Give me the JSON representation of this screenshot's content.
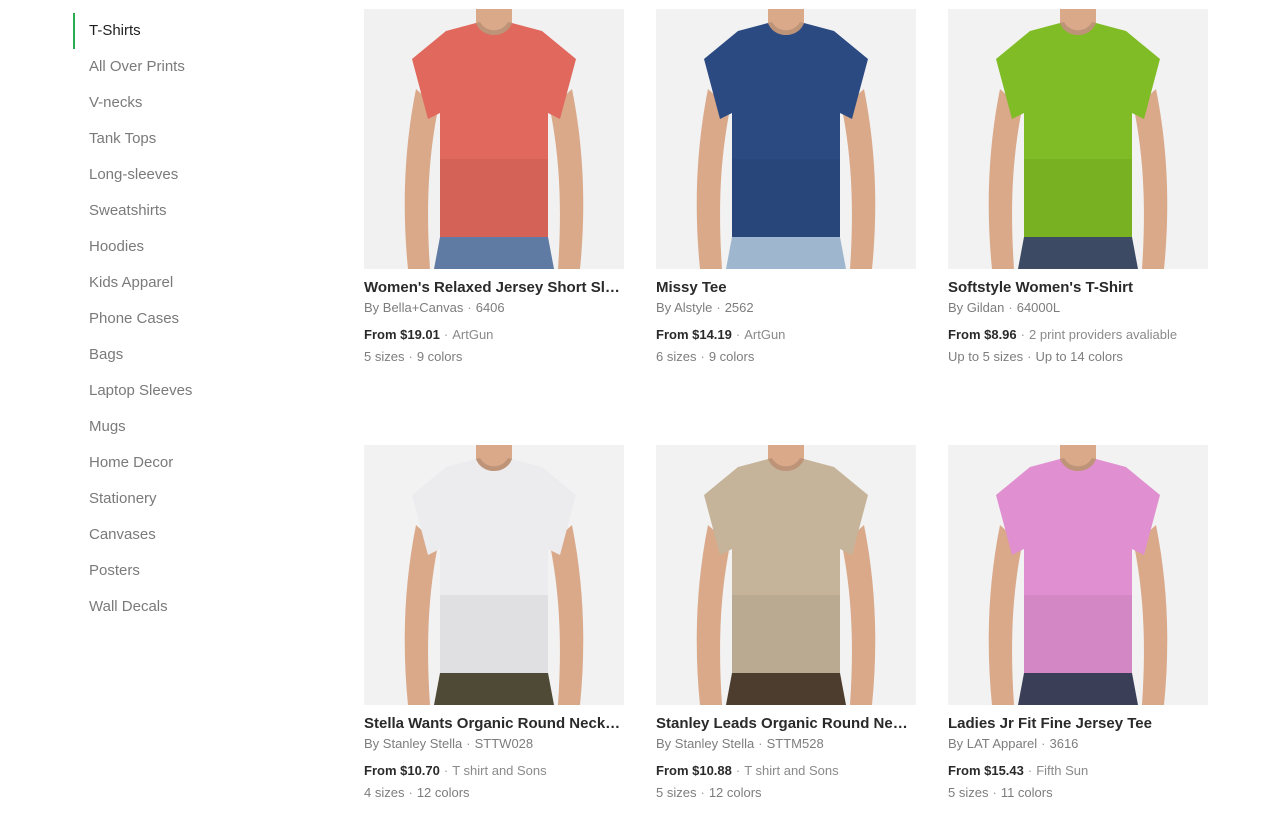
{
  "sidebar": {
    "items": [
      {
        "label": "T-Shirts",
        "active": true
      },
      {
        "label": "All Over Prints"
      },
      {
        "label": "V-necks"
      },
      {
        "label": "Tank Tops"
      },
      {
        "label": "Long-sleeves"
      },
      {
        "label": "Sweatshirts"
      },
      {
        "label": "Hoodies"
      },
      {
        "label": "Kids Apparel"
      },
      {
        "label": "Phone Cases"
      },
      {
        "label": "Bags"
      },
      {
        "label": "Laptop Sleeves"
      },
      {
        "label": "Mugs"
      },
      {
        "label": "Home Decor"
      },
      {
        "label": "Stationery"
      },
      {
        "label": "Canvases"
      },
      {
        "label": "Posters"
      },
      {
        "label": "Wall Decals"
      }
    ]
  },
  "products": [
    {
      "title": "Women's Relaxed Jersey Short Sleeve Tee",
      "brand": "By Bella+Canvas",
      "model": "6406",
      "price": "From $19.01",
      "provider": "ArtGun",
      "sizes": "5 sizes",
      "colors": "9 colors",
      "shirt_color": "#e0685c",
      "bottom_color": "#5f7aa3",
      "bg_color": "#f1f1f1"
    },
    {
      "title": "Missy Tee",
      "brand": "By Alstyle",
      "model": "2562",
      "price": "From $14.19",
      "provider": "ArtGun",
      "sizes": "6 sizes",
      "colors": "9 colors",
      "shirt_color": "#2c4a82",
      "bottom_color": "#9fb6cf",
      "bg_color": "#f2f2f2"
    },
    {
      "title": "Softstyle Women's T-Shirt",
      "brand": "By Gildan",
      "model": "64000L",
      "price": "From $8.96",
      "provider": "2 print providers avaliable",
      "sizes": "Up to 5 sizes",
      "colors": "Up to 14 colors",
      "shirt_color": "#7fbc25",
      "bottom_color": "#3d4a63",
      "bg_color": "#f2f2f2"
    },
    {
      "title": "Stella Wants Organic Round Neck T-Shirt",
      "brand": "By Stanley Stella",
      "model": "STTW028",
      "price": "From $10.70",
      "provider": "T shirt and Sons",
      "sizes": "4 sizes",
      "colors": "12 colors",
      "shirt_color": "#ecebee",
      "bottom_color": "#4f4a35",
      "bg_color": "#f2f2f2"
    },
    {
      "title": "Stanley Leads Organic Round Neck T-Shirt",
      "brand": "By Stanley Stella",
      "model": "STTM528",
      "price": "From $10.88",
      "provider": "T shirt and Sons",
      "sizes": "5 sizes",
      "colors": "12 colors",
      "shirt_color": "#c6b49a",
      "bottom_color": "#4d3d2f",
      "bg_color": "#f2f2f2"
    },
    {
      "title": "Ladies Jr Fit Fine Jersey Tee",
      "brand": "By LAT Apparel",
      "model": "3616",
      "price": "From $15.43",
      "provider": "Fifth Sun",
      "sizes": "5 sizes",
      "colors": "11 colors",
      "shirt_color": "#e08fd0",
      "bottom_color": "#3a3f57",
      "bg_color": "#f2f2f2"
    }
  ]
}
